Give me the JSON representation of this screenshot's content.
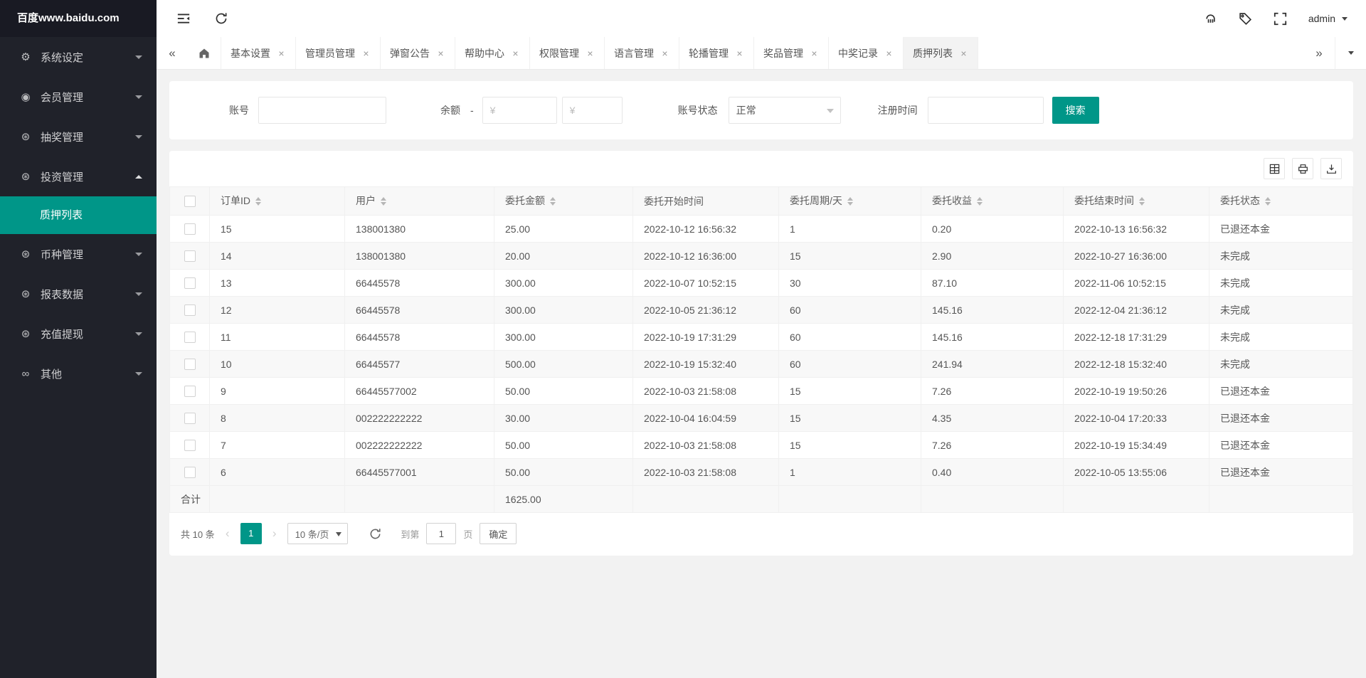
{
  "sidebar": {
    "brand": "百度www.baidu.com",
    "menu": [
      {
        "label": "系统设定",
        "icon": "⚙"
      },
      {
        "label": "会员管理",
        "icon": "◉"
      },
      {
        "label": "抽奖管理",
        "icon": "⊛"
      },
      {
        "label": "投资管理",
        "icon": "⊛"
      },
      {
        "label": "币种管理",
        "icon": "⊛"
      },
      {
        "label": "报表数据",
        "icon": "⊛"
      },
      {
        "label": "充值提现",
        "icon": "⊛"
      },
      {
        "label": "其他",
        "icon": "∞"
      }
    ],
    "submenu_active": "质押列表"
  },
  "header": {
    "username": "admin"
  },
  "tabs": {
    "items": [
      {
        "label": "基本设置"
      },
      {
        "label": "管理员管理"
      },
      {
        "label": "弹窗公告"
      },
      {
        "label": "帮助中心"
      },
      {
        "label": "权限管理"
      },
      {
        "label": "语言管理"
      },
      {
        "label": "轮播管理"
      },
      {
        "label": "奖品管理"
      },
      {
        "label": "中奖记录"
      },
      {
        "label": "质押列表"
      }
    ]
  },
  "icons": {
    "close": "×",
    "scroll_left": "«",
    "scroll_right": "»",
    "prev": "‹",
    "next": "›"
  },
  "filters": {
    "account_label": "账号",
    "balance_label": "余额",
    "balance_sep": "-",
    "yuan": "¥",
    "status_label": "账号状态",
    "status_value": "正常",
    "regtime_label": "注册时间",
    "search_button": "搜索"
  },
  "table": {
    "columns": [
      "订单ID",
      "用户",
      "委托金额",
      "委托开始时间",
      "委托周期/天",
      "委托收益",
      "委托结束时间",
      "委托状态"
    ],
    "rows": [
      [
        "15",
        "138001380",
        "25.00",
        "2022-10-12 16:56:32",
        "1",
        "0.20",
        "2022-10-13 16:56:32",
        "已退还本金"
      ],
      [
        "14",
        "138001380",
        "20.00",
        "2022-10-12 16:36:00",
        "15",
        "2.90",
        "2022-10-27 16:36:00",
        "未完成"
      ],
      [
        "13",
        "66445578",
        "300.00",
        "2022-10-07 10:52:15",
        "30",
        "87.10",
        "2022-11-06 10:52:15",
        "未完成"
      ],
      [
        "12",
        "66445578",
        "300.00",
        "2022-10-05 21:36:12",
        "60",
        "145.16",
        "2022-12-04 21:36:12",
        "未完成"
      ],
      [
        "11",
        "66445578",
        "300.00",
        "2022-10-19 17:31:29",
        "60",
        "145.16",
        "2022-12-18 17:31:29",
        "未完成"
      ],
      [
        "10",
        "66445577",
        "500.00",
        "2022-10-19 15:32:40",
        "60",
        "241.94",
        "2022-12-18 15:32:40",
        "未完成"
      ],
      [
        "9",
        "66445577002",
        "50.00",
        "2022-10-03 21:58:08",
        "15",
        "7.26",
        "2022-10-19 19:50:26",
        "已退还本金"
      ],
      [
        "8",
        "002222222222",
        "30.00",
        "2022-10-04 16:04:59",
        "15",
        "4.35",
        "2022-10-04 17:20:33",
        "已退还本金"
      ],
      [
        "7",
        "002222222222",
        "50.00",
        "2022-10-03 21:58:08",
        "15",
        "7.26",
        "2022-10-19 15:34:49",
        "已退还本金"
      ],
      [
        "6",
        "66445577001",
        "50.00",
        "2022-10-03 21:58:08",
        "1",
        "0.40",
        "2022-10-05 13:55:06",
        "已退还本金"
      ]
    ],
    "total_label": "合计",
    "total_amount": "1625.00"
  },
  "pagination": {
    "total": "共 10 条",
    "page": "1",
    "page_size": "10 条/页",
    "goto_prefix": "到第",
    "goto_value": "1",
    "goto_suffix": "页",
    "confirm": "确定"
  },
  "colors": {
    "accent": "#009688",
    "sidebar": "#20222a"
  }
}
